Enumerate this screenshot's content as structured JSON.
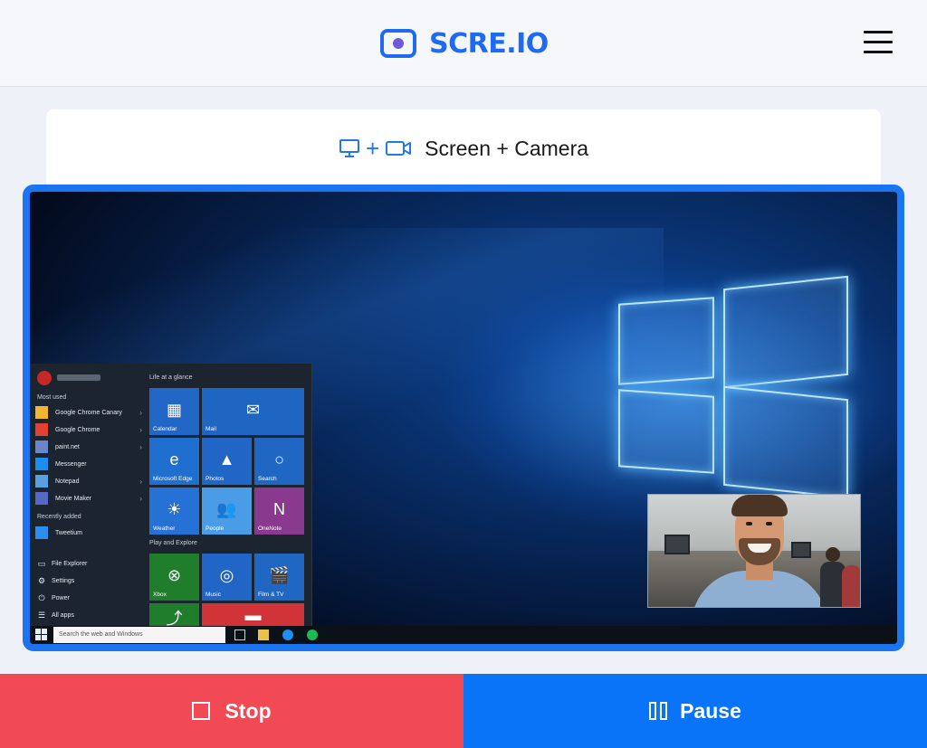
{
  "header": {
    "brand": "SCRE.IO",
    "logo_icon": "record-camera-icon",
    "menu_icon": "hamburger-menu-icon"
  },
  "mode": {
    "label": "Screen + Camera",
    "plus": "+",
    "icons": [
      "monitor-icon",
      "video-camera-icon"
    ]
  },
  "preview": {
    "start_menu": {
      "most_used_heading": "Most used",
      "most_used": [
        {
          "label": "Google Chrome Canary",
          "arrow": "›",
          "color": "#f2b632"
        },
        {
          "label": "Google Chrome",
          "arrow": "›",
          "color": "#e34133"
        },
        {
          "label": "paint.net",
          "arrow": "›",
          "color": "#6a86c9"
        },
        {
          "label": "Messenger",
          "arrow": "",
          "color": "#1d8ef0"
        },
        {
          "label": "Notepad",
          "arrow": "›",
          "color": "#5aa0e0"
        },
        {
          "label": "Movie Maker",
          "arrow": "›",
          "color": "#5569c6"
        }
      ],
      "recently_added_heading": "Recently added",
      "recently_added": [
        {
          "label": "Tweetium",
          "arrow": "",
          "color": "#2e8ef0"
        }
      ],
      "system": [
        {
          "label": "File Explorer",
          "glyph": "▭"
        },
        {
          "label": "Settings",
          "glyph": "⚙"
        },
        {
          "label": "Power",
          "glyph": "⏻"
        },
        {
          "label": "All apps",
          "glyph": "☰"
        }
      ],
      "life_heading": "Life at a glance",
      "play_heading": "Play and Explore",
      "tiles": [
        {
          "label": "Calendar",
          "glyph": "▦",
          "color": "#2267c6"
        },
        {
          "label": "Mail",
          "glyph": "✉",
          "color": "#1f66c2"
        },
        {
          "label": "Microsoft Edge",
          "glyph": "e",
          "color": "#1f6fd1"
        },
        {
          "label": "Photos",
          "glyph": "▲",
          "color": "#2166c6"
        },
        {
          "label": "Search",
          "glyph": "○",
          "color": "#2067c4"
        },
        {
          "label": "Weather",
          "glyph": "☀",
          "color": "#2671d6"
        },
        {
          "label": "People",
          "glyph": "👥",
          "color": "#4b9ce6"
        },
        {
          "label": "OneNote",
          "glyph": "N",
          "color": "#8a3a8e"
        },
        {
          "label": "Xbox",
          "glyph": "⊗",
          "color": "#1f7d2c"
        },
        {
          "label": "Music",
          "glyph": "◎",
          "color": "#2166c6"
        },
        {
          "label": "Film & TV",
          "glyph": "🎬",
          "color": "#2067c4"
        },
        {
          "label": "",
          "glyph": "⤴",
          "color": "#1f7d2c"
        },
        {
          "label": "",
          "glyph": "▬",
          "color": "#d13438"
        }
      ]
    },
    "taskbar": {
      "search_placeholder": "Search the web and Windows",
      "start_icon": "windows-start-icon",
      "apps": [
        "task-view-icon",
        "file-explorer-icon",
        "messenger-icon",
        "spotify-icon"
      ]
    }
  },
  "actions": {
    "stop_label": "Stop",
    "pause_label": "Pause"
  },
  "colors": {
    "brand": "#1f6bf0",
    "preview_border": "#1b74f0",
    "stop": "#f24a55",
    "pause": "#0a74f8"
  }
}
